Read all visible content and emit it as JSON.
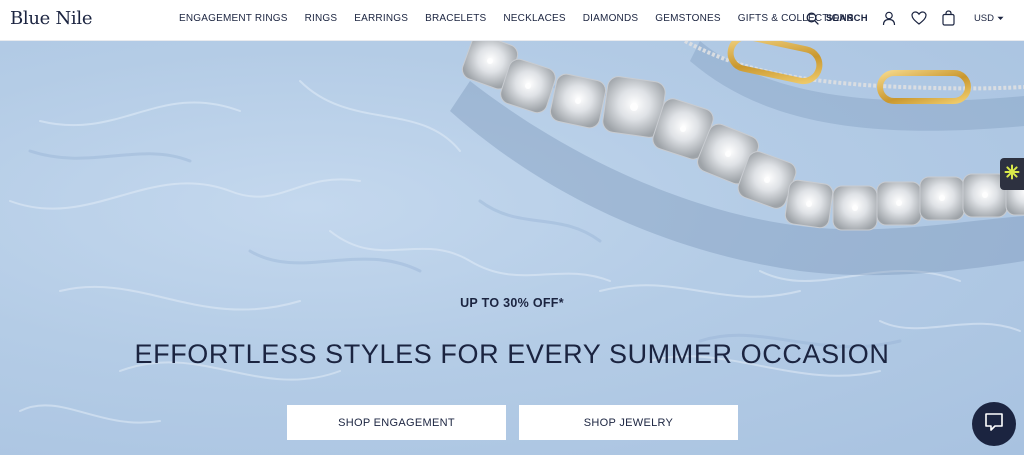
{
  "brand": {
    "name": "Blue Nile"
  },
  "nav": {
    "items": [
      "ENGAGEMENT RINGS",
      "RINGS",
      "EARRINGS",
      "BRACELETS",
      "NECKLACES",
      "DIAMONDS",
      "GEMSTONES",
      "GIFTS & COLLECTIONS"
    ]
  },
  "utilities": {
    "search_label": "SEARCH",
    "currency": "USD",
    "icons": [
      "search-icon",
      "account-icon",
      "wishlist-heart-icon",
      "shopping-bag-icon",
      "chevron-down-icon"
    ]
  },
  "hero": {
    "eyebrow": "UP TO 30% OFF*",
    "title": "EFFORTLESS STYLES FOR EVERY SUMMER OCCASION",
    "buttons": {
      "engagement": "SHOP ENGAGEMENT",
      "jewelry": "SHOP JEWELRY"
    }
  },
  "colors": {
    "navy": "#1b2440",
    "hero_blue": "#b4cce6",
    "gold": "#d6a93c",
    "widget_dark": "#2d3140",
    "widget_accent": "#d9e94a"
  }
}
